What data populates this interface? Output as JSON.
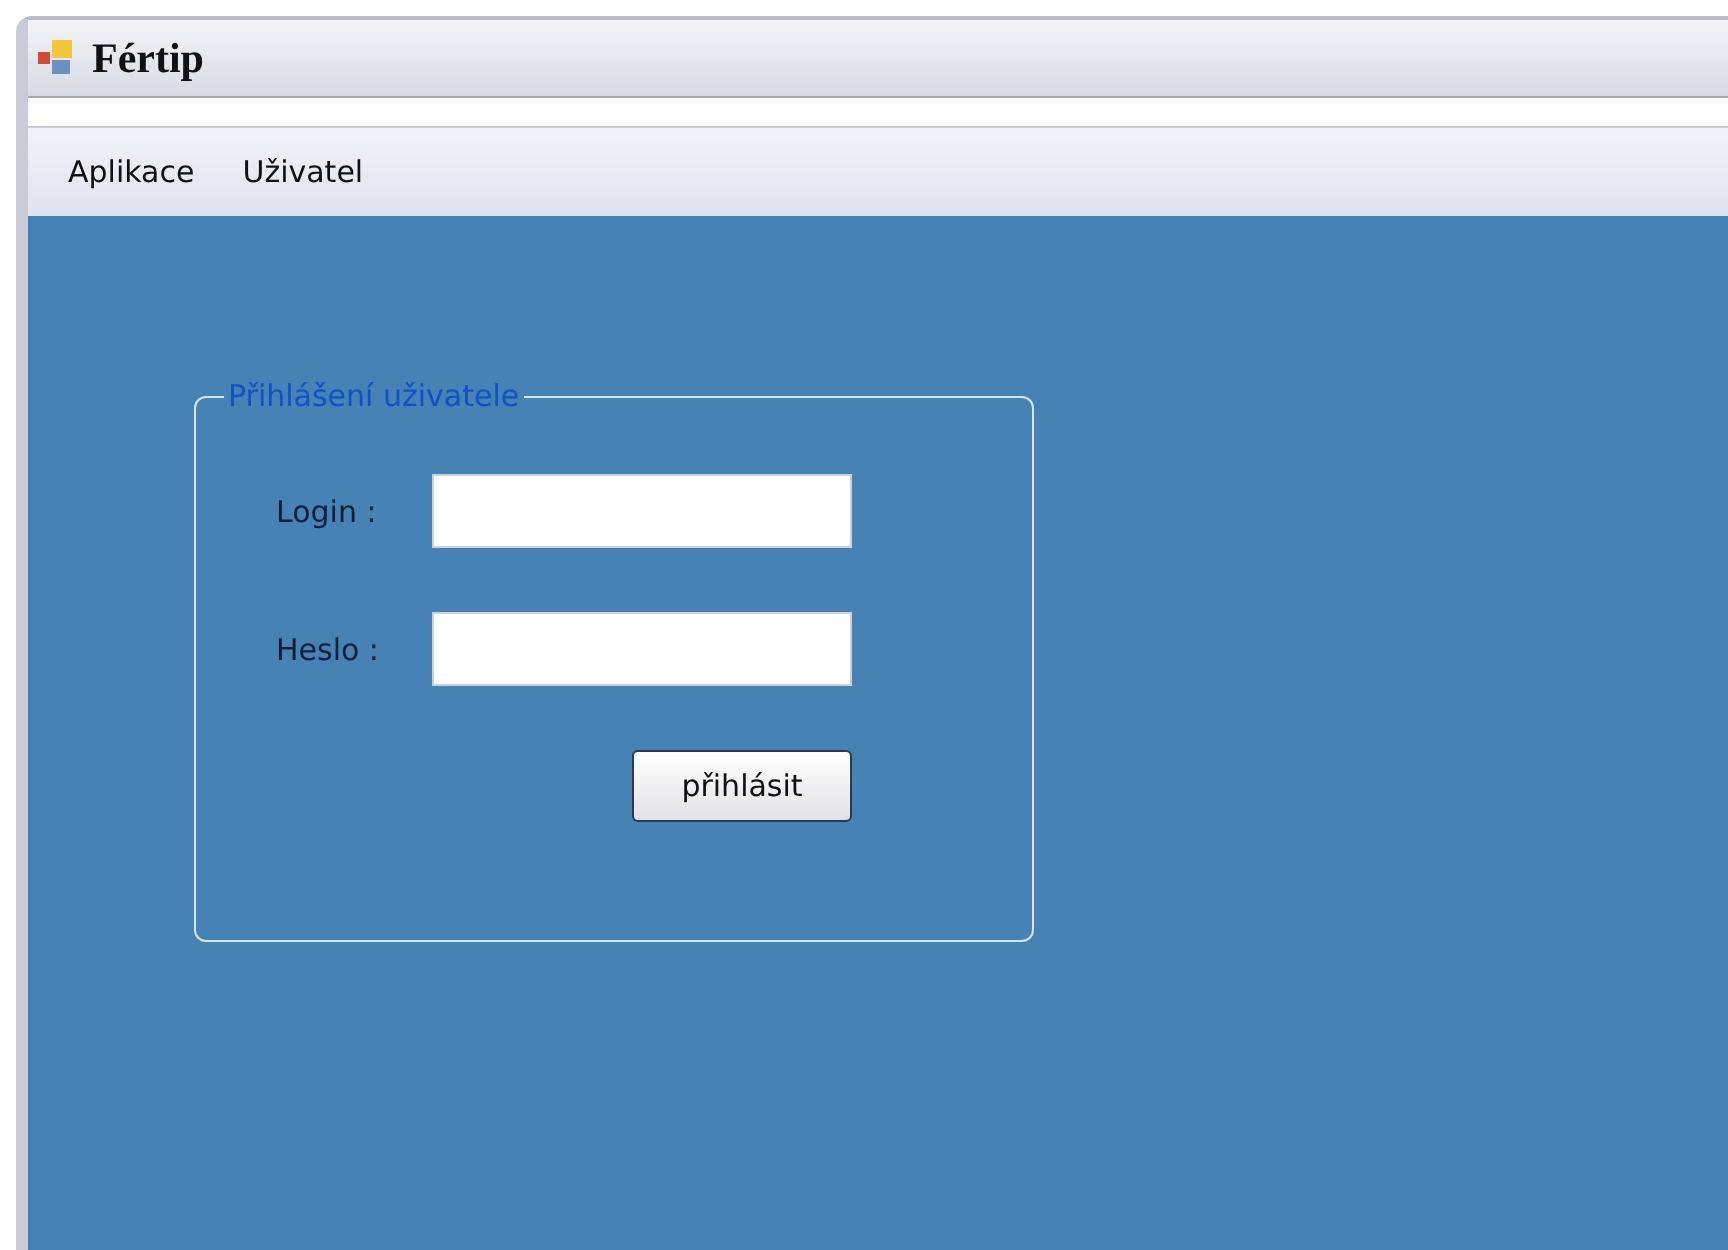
{
  "window": {
    "title": "Fértip"
  },
  "menu": [
    {
      "label": "Aplikace"
    },
    {
      "label": "Uživatel"
    }
  ],
  "login_group": {
    "title": "Přihlášení uživatele",
    "fields": [
      {
        "label": "Login :"
      },
      {
        "label": "Heslo :"
      }
    ],
    "button": "přihlásit"
  }
}
